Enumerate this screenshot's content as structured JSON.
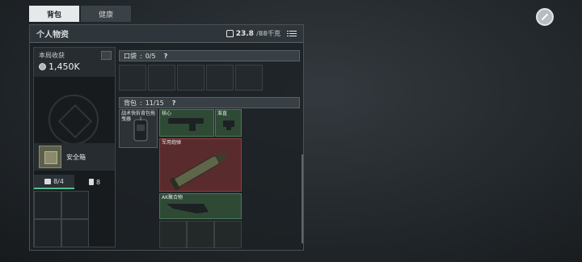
{
  "tabs": [
    {
      "label": "背包",
      "active": true
    },
    {
      "label": "健康",
      "active": false
    }
  ],
  "panel": {
    "title": "个人物资",
    "weight_current": "23.8",
    "weight_cap": "/88千克"
  },
  "earnings": {
    "label": "本局收获",
    "value": "1,450K"
  },
  "safe": {
    "label": "安全箱"
  },
  "sub_tabs": [
    {
      "label": "8/4"
    },
    {
      "label": "8"
    }
  ],
  "pocket": {
    "label": "口袋",
    "count": "0/5",
    "help": "?"
  },
  "backpack": {
    "label": "背包",
    "count": "11/15",
    "help": "?"
  },
  "items": {
    "tactical_rig": "战术快拆背包拖曳器",
    "core": "核心",
    "scope": "准直",
    "cannon": "军用炮弹",
    "ak_stock": "AK聚合物"
  },
  "colors": {
    "accent_green": "#4fc08d",
    "item_red": "#5a2b2d",
    "item_green": "#2e4a35"
  }
}
